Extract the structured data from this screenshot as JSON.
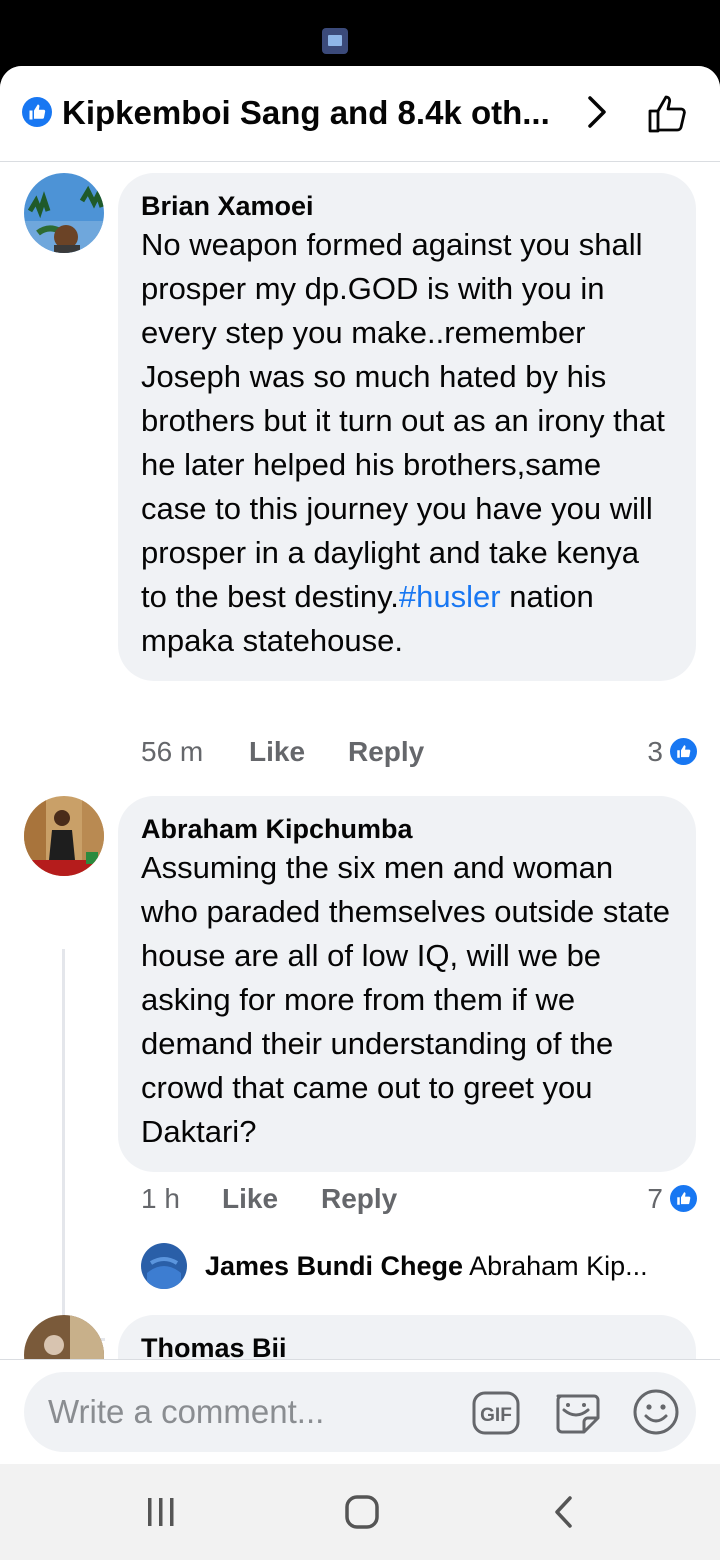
{
  "header": {
    "title": "Kipkemboi Sang and 8.4k oth..."
  },
  "comments": [
    {
      "author": "Brian Xamoei",
      "text_before": "No weapon formed against you shall prosper my dp.GOD is with you in every step you make..remember Joseph was so much hated by his brothers but it turn out as an irony that he later helped his brothers,same case to this journey you have you will prosper in a daylight and take kenya to the best destiny.",
      "hashtag": "#husler",
      "text_after": " nation mpaka statehouse.",
      "time": "56 m",
      "like_label": "Like",
      "reply_label": "Reply",
      "reaction_count": "3"
    },
    {
      "author": "Abraham Kipchumba",
      "text": "Assuming the six men and woman who paraded themselves outside state house are all of low IQ, will we be asking for more from them if we demand their understanding of the crowd that came out to greet you Daktari?",
      "time": "1 h",
      "like_label": "Like",
      "reply_label": "Reply",
      "reaction_count": "7",
      "reply_preview": {
        "author": "James Bundi Chege",
        "text": "Abraham Kip..."
      }
    },
    {
      "author": "Thomas Bii"
    }
  ],
  "composer": {
    "placeholder": "Write a comment..."
  },
  "icons": {
    "like_badge": "thumbs-up-icon",
    "chevron": "chevron-right-icon",
    "gif": "gif-icon",
    "sticker": "sticker-icon",
    "emoji": "emoji-icon",
    "nav_recents": "recents-icon",
    "nav_home": "home-icon",
    "nav_back": "back-icon"
  },
  "colors": {
    "accent": "#1877f2",
    "bubble": "#f0f2f5",
    "secondary_text": "#65676b"
  }
}
